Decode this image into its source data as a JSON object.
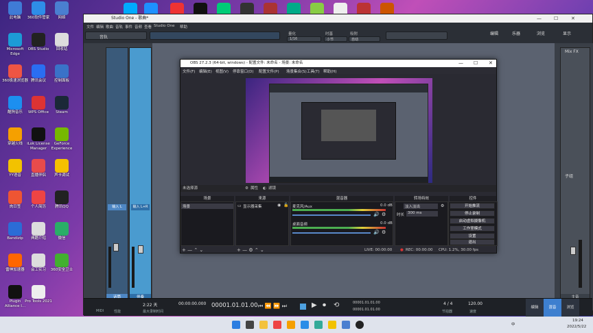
{
  "desktop": {
    "icons": [
      {
        "label": "此电脑",
        "color": "#3f7bd6"
      },
      {
        "label": "360软件管家",
        "color": "#2e8de8"
      },
      {
        "label": "网络",
        "color": "#4a7fd0"
      },
      {
        "label": "Microsoft Edge",
        "color": "#1c9bd6"
      },
      {
        "label": "OBS Studio",
        "color": "#222"
      },
      {
        "label": "回收站",
        "color": "#ddd"
      },
      {
        "label": "360极速浏览器",
        "color": "#e54"
      },
      {
        "label": "腾讯会议",
        "color": "#2a6ef2"
      },
      {
        "label": "控制面板",
        "color": "#3a72c8"
      },
      {
        "label": "酷狗音乐",
        "color": "#1c8ff0"
      },
      {
        "label": "WPS Office",
        "color": "#d33"
      },
      {
        "label": "Steam",
        "color": "#1b2838"
      },
      {
        "label": "穿越火线",
        "color": "#f5a000"
      },
      {
        "label": "iLok License Manager",
        "color": "#111"
      },
      {
        "label": "GeForce Experience",
        "color": "#76b900"
      },
      {
        "label": "YY语音",
        "color": "#f2c200"
      },
      {
        "label": "直播伴侣",
        "color": "#e94b4b"
      },
      {
        "label": "声卡调试",
        "color": "#f5c000"
      },
      {
        "label": "肉日签",
        "color": "#e53"
      },
      {
        "label": "个人简历",
        "color": "#e44"
      },
      {
        "label": "腾讯QQ",
        "color": "#222"
      },
      {
        "label": "Bandizip",
        "color": "#2b6cd6"
      },
      {
        "label": "典籍介绍",
        "color": "#ddd"
      },
      {
        "label": "微信",
        "color": "#2aae67"
      },
      {
        "label": "雷神加速器",
        "color": "#f60"
      },
      {
        "label": "会工实习",
        "color": "#ddd"
      },
      {
        "label": "360安全卫士",
        "color": "#42b02f"
      },
      {
        "label": "Plugin Alliance I...",
        "color": "#111"
      },
      {
        "label": "Pro Tools 2021",
        "color": "#eee"
      }
    ]
  },
  "studio_one": {
    "title": "Studio One - 歌曲*",
    "menu": [
      "文件",
      "编辑",
      "歌曲",
      "音轨",
      "事件",
      "音频",
      "查看",
      "Studio One",
      "帮助"
    ],
    "song_label": "音轨",
    "toolbar_labels": [
      "量化",
      "时基",
      "吸附"
    ],
    "toolbar_values": [
      "1/16",
      "小节",
      "自动"
    ],
    "right_buttons": [
      "编辑",
      "乐器",
      "浏览",
      "显示"
    ],
    "tracks": [
      {
        "name": "输入 L",
        "label": "话筒",
        "input": "输入 L"
      },
      {
        "name": "输入 L+R",
        "label": "伴奏",
        "input": "输入 L+R"
      }
    ],
    "bus_label": "Mix FX",
    "right_panel_label": "子组",
    "main_label": "主音",
    "transport": {
      "time_sig": "4 / 4",
      "tempo": "120.00",
      "position": "00001.01.01.00",
      "sec_time": "00:00:00.000",
      "loop_start": "00001.01.01.00",
      "loop_end": "00001.01.01.00",
      "sample_info": "2:22 天",
      "record_info": "最大录制时间",
      "midi": "MIDI",
      "perf": "性能",
      "tempo_label": "速度",
      "timesig_label": "节拍器"
    },
    "bottom_tabs": [
      "编辑",
      "混音",
      "浏览"
    ]
  },
  "obs": {
    "title": "OBS 27.2.3 (64-bit, windows) - 配置文件: 未命名 - 场景: 未命名",
    "menu": [
      "文件(F)",
      "编辑(E)",
      "视图(V)",
      "停靠窗口(D)",
      "配置文件(P)",
      "场景集合(S)",
      "工具(T)",
      "帮助(H)"
    ],
    "no_source": "未选择源",
    "props": "属性",
    "filters": "滤镜",
    "docks": {
      "scenes": "场景",
      "sources": "来源",
      "mixer": "混音器",
      "transitions": "转场特效",
      "controls": "控件"
    },
    "scene_items": [
      "场景"
    ],
    "source_items": [
      "显示器采集"
    ],
    "mixer": [
      {
        "name": "麦克风/Aux",
        "db": "0.0 dB"
      },
      {
        "name": "桌面音频",
        "db": "0.0 dB"
      }
    ],
    "transition": {
      "type": "淡入淡出",
      "duration_label": "时长",
      "duration": "300 ms"
    },
    "controls": [
      "开始推流",
      "停止录制",
      "启动虚拟摄像机",
      "工作室模式",
      "设置",
      "退出"
    ],
    "status": {
      "live": "LIVE: 00:00:00",
      "rec": "REC: 00:00:00",
      "cpu": "CPU: 1.2%, 30.00 fps"
    }
  },
  "taskbar": {
    "time": "19:24",
    "date": "2022/5/22",
    "lang": "中"
  }
}
